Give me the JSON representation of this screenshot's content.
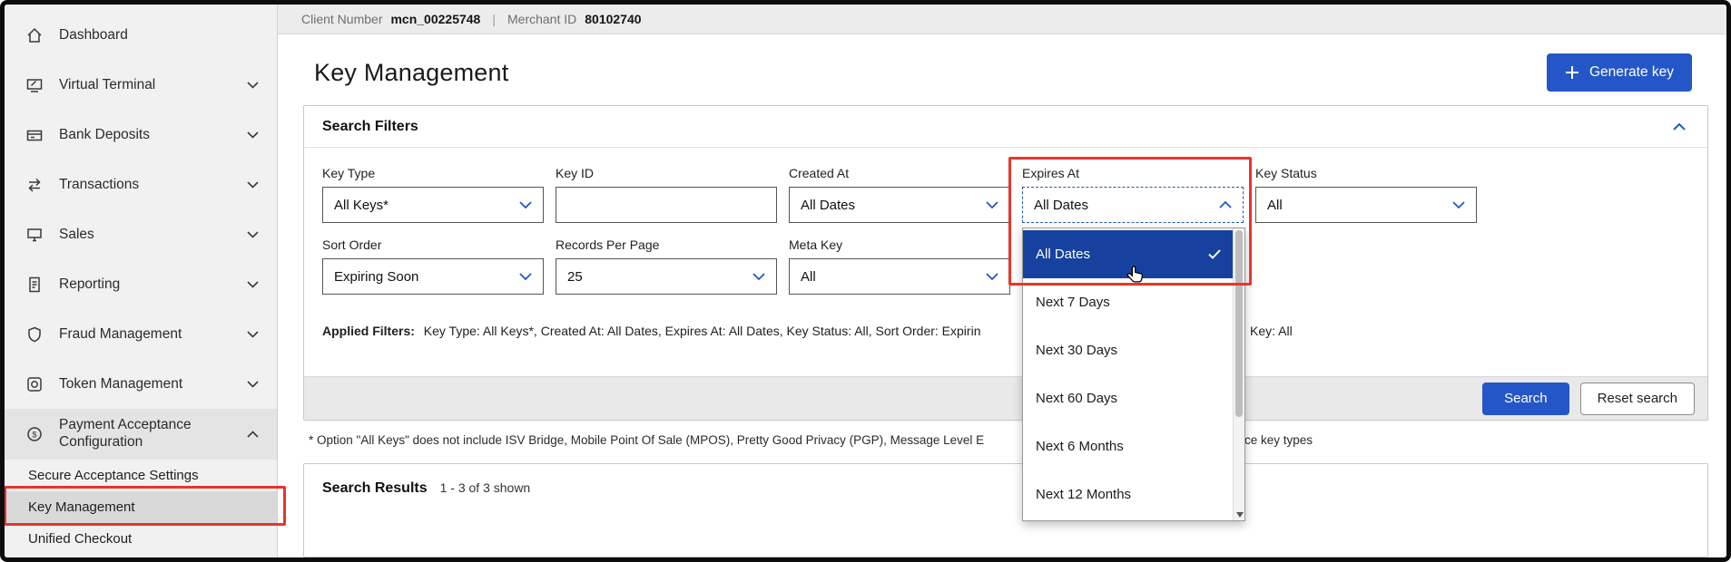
{
  "colors": {
    "accent_blue": "#2456c7",
    "selected_blue": "#16419e",
    "annotation_red": "#e8352b"
  },
  "topbar": {
    "client_number_label": "Client Number",
    "client_number_value": "mcn_00225748",
    "separator": "|",
    "merchant_id_label": "Merchant ID",
    "merchant_id_value": "80102740"
  },
  "sidebar": {
    "items": [
      {
        "label": "Dashboard",
        "icon": "home-icon",
        "expandable": false
      },
      {
        "label": "Virtual Terminal",
        "icon": "terminal-icon",
        "expandable": true
      },
      {
        "label": "Bank Deposits",
        "icon": "bank-deposit-icon",
        "expandable": true
      },
      {
        "label": "Transactions",
        "icon": "transactions-icon",
        "expandable": true
      },
      {
        "label": "Sales",
        "icon": "sales-icon",
        "expandable": true
      },
      {
        "label": "Reporting",
        "icon": "report-icon",
        "expandable": true
      },
      {
        "label": "Fraud Management",
        "icon": "shield-icon",
        "expandable": true
      },
      {
        "label": "Token Management",
        "icon": "token-icon",
        "expandable": true
      },
      {
        "label": "Payment Acceptance Configuration",
        "icon": "payment-icon",
        "expandable": true,
        "expanded": true
      }
    ],
    "subitems": [
      "Secure Acceptance Settings",
      "Key Management",
      "Unified Checkout"
    ],
    "active_subitem": "Key Management"
  },
  "page": {
    "title": "Key Management",
    "generate_key_label": "Generate key"
  },
  "filters": {
    "panel_title": "Search Filters",
    "row1": [
      {
        "label": "Key Type",
        "value": "All Keys*"
      },
      {
        "label": "Key ID",
        "value": ""
      },
      {
        "label": "Created At",
        "value": "All Dates"
      },
      {
        "label": "Expires At",
        "value": "All Dates"
      },
      {
        "label": "Key Status",
        "value": "All"
      }
    ],
    "row2": [
      {
        "label": "Sort Order",
        "value": "Expiring Soon"
      },
      {
        "label": "Records Per Page",
        "value": "25"
      },
      {
        "label": "Meta Key",
        "value": "All"
      }
    ],
    "dropdown": {
      "options": [
        "All Dates",
        "Next 7 Days",
        "Next 30 Days",
        "Next 60 Days",
        "Next 6 Months",
        "Next 12 Months"
      ],
      "selected": "All Dates"
    },
    "applied_label": "Applied Filters:",
    "applied_left": "Key Type: All Keys*,  Created At: All Dates,  Expires At: All Dates,  Key Status: All,  Sort Order: Expirin",
    "applied_right": "Key: All",
    "search_button": "Search",
    "reset_button": "Reset search"
  },
  "footnote": {
    "left": "* Option \"All Keys\" does not include ISV Bridge, Mobile Point Of Sale (MPOS), Pretty Good Privacy (PGP), Message Level E",
    "right": "ce key types"
  },
  "results": {
    "title": "Search Results",
    "count": "1 - 3 of 3 shown"
  }
}
